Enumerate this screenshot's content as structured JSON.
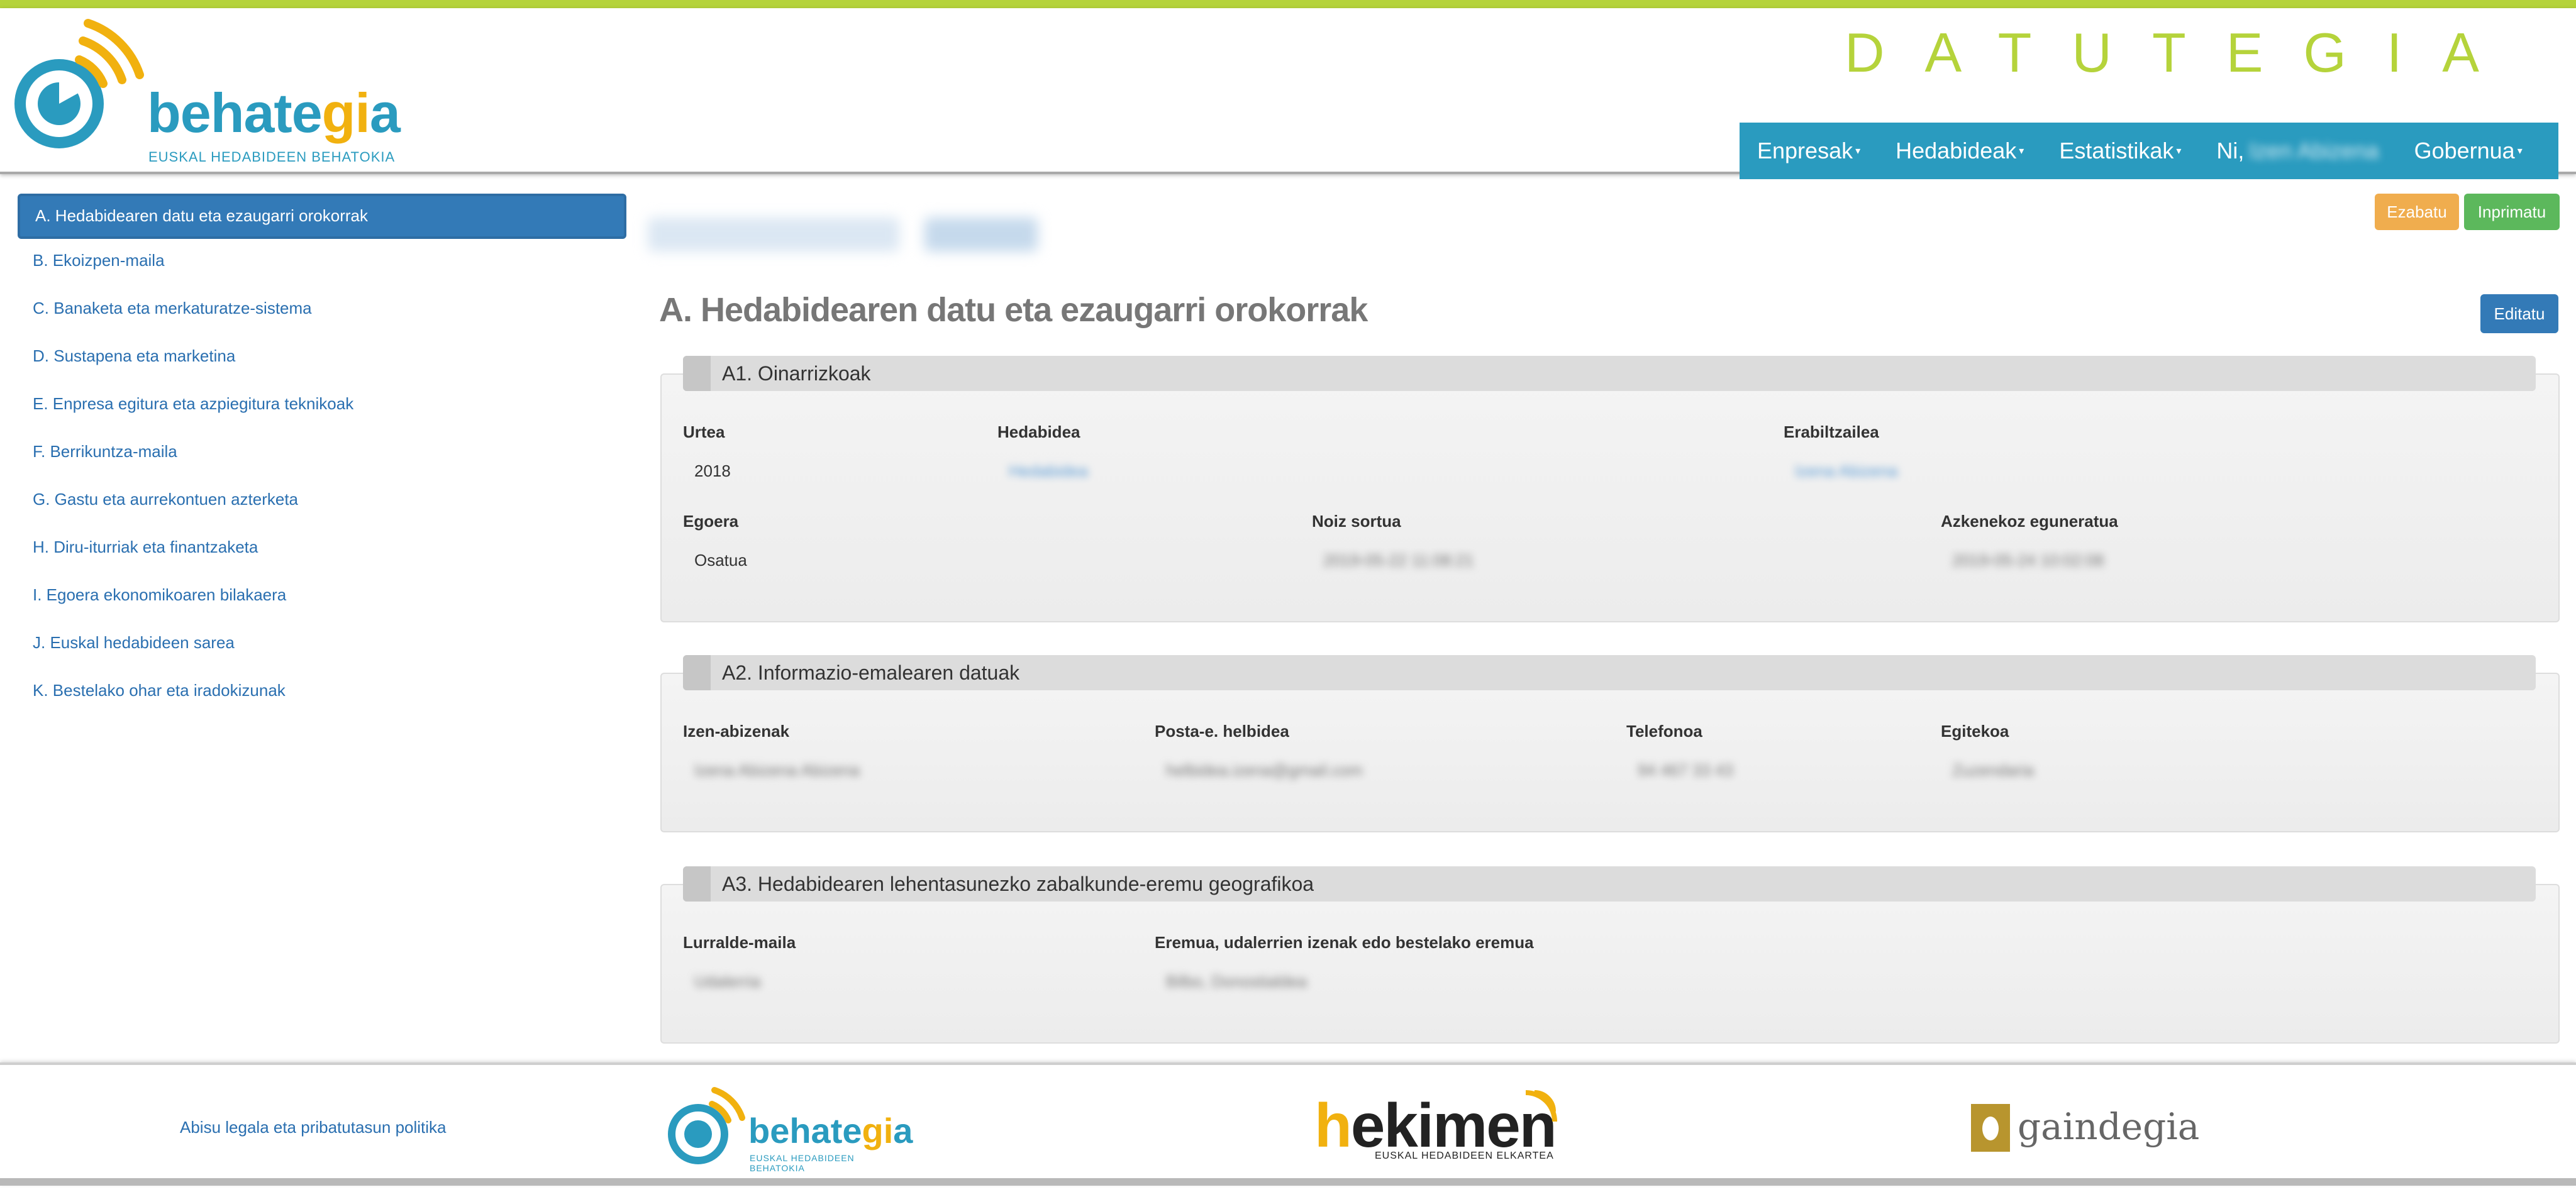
{
  "header": {
    "brand_title": "DATUTEGIA",
    "logo_word_main": "behate",
    "logo_word_accent": "gi",
    "logo_word_end": "a",
    "logo_subtitle": "EUSKAL HEDABIDEEN BEHATOKIA",
    "nav": [
      {
        "label": "Enpresak"
      },
      {
        "label": "Hedabideak"
      },
      {
        "label": "Estatistikak"
      },
      {
        "label": "Ni,",
        "user": "Izen Abizena"
      },
      {
        "label": "Gobernua"
      }
    ]
  },
  "sidebar": {
    "items": [
      {
        "label": "A. Hedabidearen datu eta ezaugarri orokorrak",
        "active": true
      },
      {
        "label": "B. Ekoizpen-maila"
      },
      {
        "label": "C. Banaketa eta merkaturatze-sistema"
      },
      {
        "label": "D. Sustapena eta marketina"
      },
      {
        "label": "E. Enpresa egitura eta azpiegitura teknikoak"
      },
      {
        "label": "F. Berrikuntza-maila"
      },
      {
        "label": "G. Gastu eta aurrekontuen azterketa"
      },
      {
        "label": "H. Diru-iturriak eta finantzaketa"
      },
      {
        "label": "I. Egoera ekonomikoaren bilakaera"
      },
      {
        "label": "J. Euskal hedabideen sarea"
      },
      {
        "label": "K. Bestelako ohar eta iradokizunak"
      }
    ]
  },
  "actions": {
    "delete_label": "Ezabatu",
    "print_label": "Inprimatu",
    "edit_label": "Editatu"
  },
  "main": {
    "title": "A. Hedabidearen datu eta ezaugarri orokorrak",
    "panels": [
      {
        "title": "A1. Oinarrizkoak",
        "fields": {
          "urtea_label": "Urtea",
          "urtea_value": "2018",
          "hedabidea_label": "Hedabidea",
          "hedabidea_value": "Hedabidea",
          "erabiltzailea_label": "Erabiltzailea",
          "erabiltzailea_value": "Izena Abizena",
          "egoera_label": "Egoera",
          "egoera_value": "Osatua",
          "noiz_label": "Noiz sortua",
          "noiz_value": "2019-05-22 11:08:21",
          "azken_label": "Azkenekoz eguneratua",
          "azken_value": "2019-05-24 10:02:08"
        }
      },
      {
        "title": "A2. Informazio-emalearen datuak",
        "fields": {
          "izen_label": "Izen-abizenak",
          "izen_value": "Izena Abizena Abizena",
          "posta_label": "Posta-e. helbidea",
          "posta_value": "helbidea.izena@gmail.com",
          "tel_label": "Telefonoa",
          "tel_value": "94 467 33 43",
          "egitekoa_label": "Egitekoa",
          "egitekoa_value": "Zuzendaria"
        }
      },
      {
        "title": "A3. Hedabidearen lehentasunezko zabalkunde-eremu geografikoa",
        "fields": {
          "lurralde_label": "Lurralde-maila",
          "lurralde_value": "Udalerria",
          "eremua_label": "Eremua, udalerrien izenak edo bestelako eremua",
          "eremua_value": "Bilbo, Donostialdea"
        }
      }
    ]
  },
  "footer": {
    "legal_link": "Abisu legala eta pribatutasun politika",
    "logo1_main": "behate",
    "logo1_accent": "gi",
    "logo1_end": "a",
    "logo1_sub": "EUSKAL HEDABIDEEN BEHATOKIA",
    "logo2_accent": "h",
    "logo2_main": "ekimen",
    "logo2_sub": "EUSKAL HEDABIDEEN ELKARTEA",
    "logo3_text": "gaindegia"
  },
  "colors": {
    "accent_green": "#b5d33b",
    "nav_blue": "#2a9bbf",
    "primary": "#337ab7",
    "warning": "#f0ad4e",
    "success": "#5cb85c"
  }
}
